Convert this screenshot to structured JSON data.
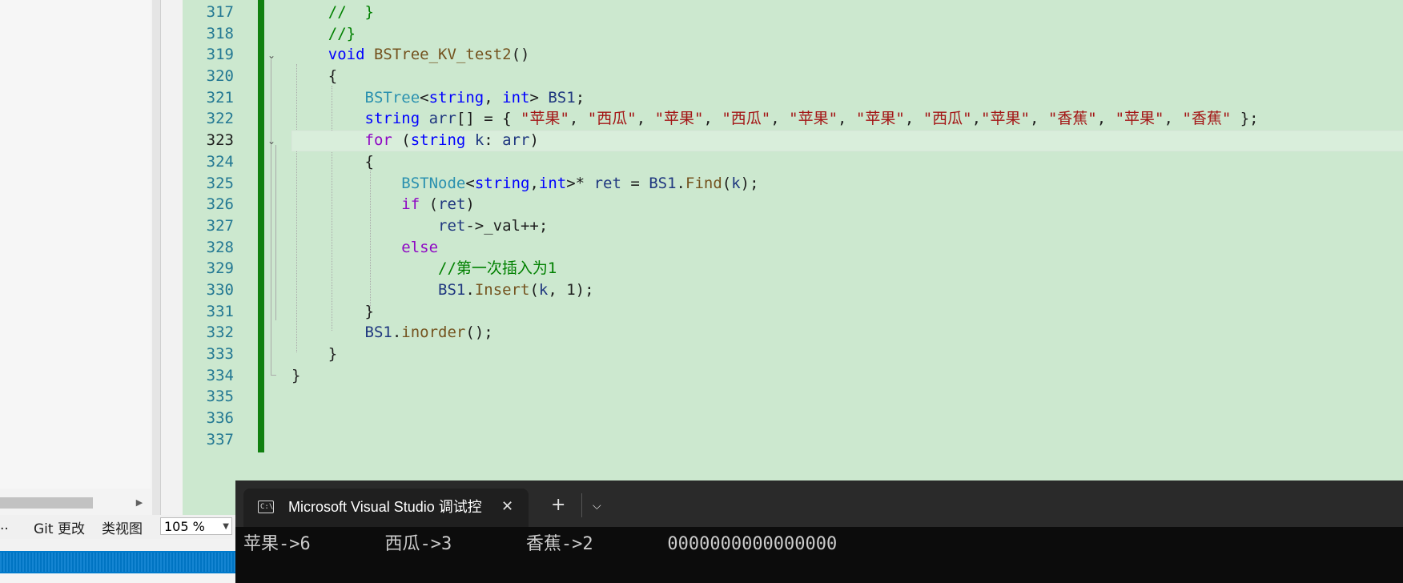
{
  "editor": {
    "line_numbers": [
      "317",
      "318",
      "319",
      "320",
      "321",
      "322",
      "323",
      "324",
      "325",
      "326",
      "327",
      "328",
      "329",
      "330",
      "331",
      "332",
      "333",
      "334",
      "335",
      "336",
      "337"
    ],
    "current_line": "323",
    "accent_change_bar": "#108010"
  },
  "code": [
    [
      [
        "cmt",
        "    //  }"
      ]
    ],
    [
      [
        "cmt",
        "    //}"
      ]
    ],
    [
      [
        "",
        "    "
      ],
      [
        "kw",
        "void"
      ],
      [
        "",
        " "
      ],
      [
        "fn",
        "BSTree_KV_test2"
      ],
      [
        "",
        "()"
      ]
    ],
    [
      [
        "",
        "    {"
      ]
    ],
    [
      [
        "",
        "        "
      ],
      [
        "type",
        "BSTree"
      ],
      [
        "",
        "<"
      ],
      [
        "kw",
        "string"
      ],
      [
        "",
        ", "
      ],
      [
        "kw",
        "int"
      ],
      [
        "",
        "> "
      ],
      [
        "loc",
        "BS1"
      ],
      [
        "",
        ";"
      ]
    ],
    [
      [
        "",
        "        "
      ],
      [
        "kw",
        "string"
      ],
      [
        "",
        " "
      ],
      [
        "loc",
        "arr"
      ],
      [
        "",
        "[] = { "
      ],
      [
        "str",
        "\"苹果\""
      ],
      [
        "",
        ", "
      ],
      [
        "str",
        "\"西瓜\""
      ],
      [
        "",
        ", "
      ],
      [
        "str",
        "\"苹果\""
      ],
      [
        "",
        ", "
      ],
      [
        "str",
        "\"西瓜\""
      ],
      [
        "",
        ", "
      ],
      [
        "str",
        "\"苹果\""
      ],
      [
        "",
        ", "
      ],
      [
        "str",
        "\"苹果\""
      ],
      [
        "",
        ", "
      ],
      [
        "str",
        "\"西瓜\""
      ],
      [
        "",
        ","
      ],
      [
        "str",
        "\"苹果\""
      ],
      [
        "",
        ", "
      ],
      [
        "str",
        "\"香蕉\""
      ],
      [
        "",
        ", "
      ],
      [
        "str",
        "\"苹果\""
      ],
      [
        "",
        ", "
      ],
      [
        "str",
        "\"香蕉\""
      ],
      [
        "",
        " };"
      ]
    ],
    [
      [
        "",
        "        "
      ],
      [
        "ctl",
        "for"
      ],
      [
        "",
        " ("
      ],
      [
        "kw",
        "string"
      ],
      [
        "",
        " "
      ],
      [
        "loc",
        "k"
      ],
      [
        "",
        ": "
      ],
      [
        "loc",
        "arr"
      ],
      [
        "",
        ")"
      ]
    ],
    [
      [
        "",
        "        {"
      ]
    ],
    [
      [
        "",
        "            "
      ],
      [
        "type",
        "BSTNode"
      ],
      [
        "",
        "<"
      ],
      [
        "kw",
        "string"
      ],
      [
        "",
        ","
      ],
      [
        "kw",
        "int"
      ],
      [
        "",
        ">* "
      ],
      [
        "loc",
        "ret"
      ],
      [
        "",
        " = "
      ],
      [
        "loc",
        "BS1"
      ],
      [
        "",
        "."
      ],
      [
        "fn",
        "Find"
      ],
      [
        "",
        "("
      ],
      [
        "loc",
        "k"
      ],
      [
        "",
        ");"
      ]
    ],
    [
      [
        "",
        "            "
      ],
      [
        "ctl",
        "if"
      ],
      [
        "",
        " ("
      ],
      [
        "loc",
        "ret"
      ],
      [
        "",
        ")"
      ]
    ],
    [
      [
        "",
        "                "
      ],
      [
        "loc",
        "ret"
      ],
      [
        "",
        "->_val++;"
      ]
    ],
    [
      [
        "",
        "            "
      ],
      [
        "ctl",
        "else"
      ]
    ],
    [
      [
        "cmt",
        "                //第一次插入为1"
      ]
    ],
    [
      [
        "",
        "                "
      ],
      [
        "loc",
        "BS1"
      ],
      [
        "",
        "."
      ],
      [
        "fn",
        "Insert"
      ],
      [
        "",
        "("
      ],
      [
        "loc",
        "k"
      ],
      [
        "",
        ", 1);"
      ]
    ],
    [
      [
        "",
        "        }"
      ]
    ],
    [
      [
        "",
        "        "
      ],
      [
        "loc",
        "BS1"
      ],
      [
        "",
        "."
      ],
      [
        "fn",
        "inorder"
      ],
      [
        "",
        "();"
      ]
    ],
    [
      [
        "",
        "    }"
      ]
    ],
    [
      [
        "",
        "}"
      ]
    ],
    [
      [
        "",
        ""
      ]
    ],
    [
      [
        "",
        ""
      ]
    ],
    [
      [
        "",
        ""
      ]
    ]
  ],
  "bottom_tabs": {
    "ellipsis": "..",
    "git_changes": "Git 更改",
    "class_view": "类视图",
    "zoom": "105 %"
  },
  "terminal": {
    "icon": "C:\\",
    "title": "Microsoft Visual Studio 调试控",
    "close_icon": "✕",
    "new_tab_icon": "+",
    "dropdown_icon": "⌵",
    "output": "苹果->6       西瓜->3       香蕉->2       0000000000000000"
  },
  "colors": {
    "editor_bg": "#cce8cf",
    "statusbar": "#007acc",
    "terminal_bg": "#0c0c0c"
  }
}
